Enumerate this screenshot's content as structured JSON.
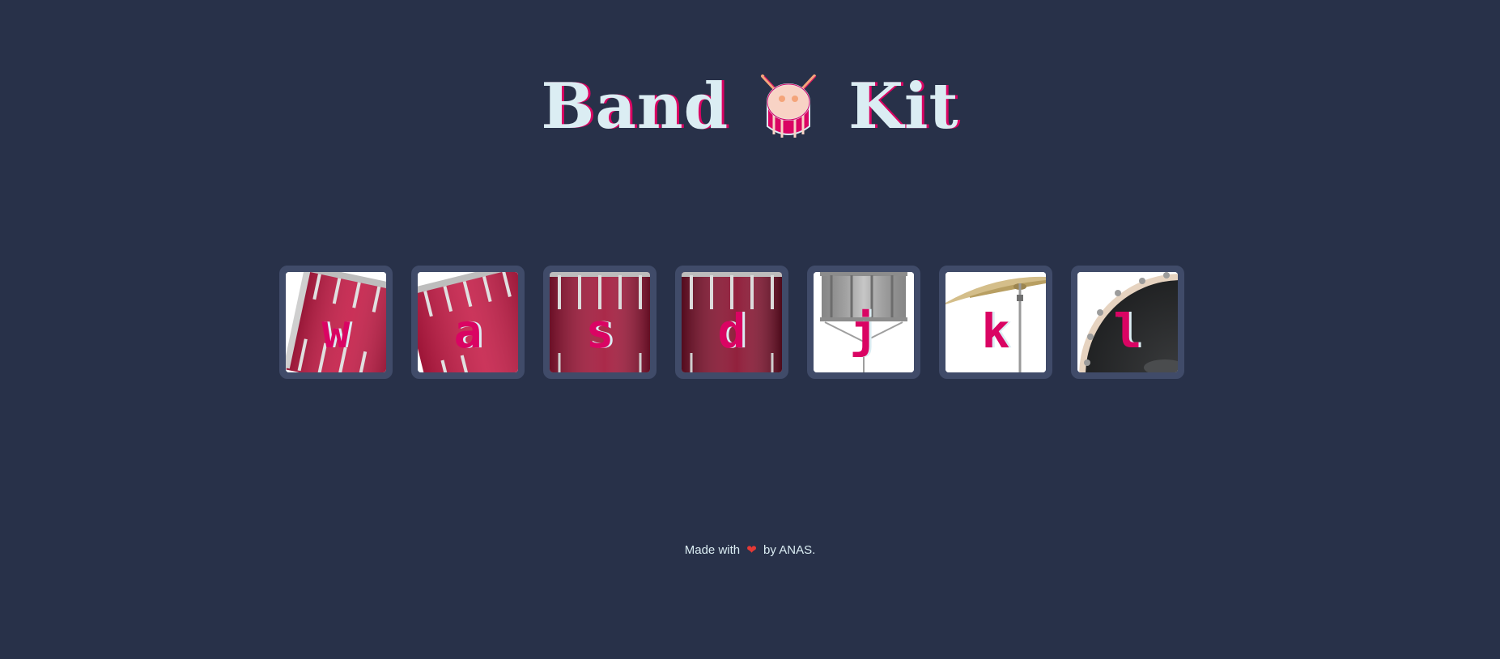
{
  "header": {
    "title_left": "Band",
    "title_right": "Kit",
    "logo_icon": "drum-icon"
  },
  "drums": [
    {
      "key": "w",
      "image": "tom-drum-red-tilted-icon"
    },
    {
      "key": "a",
      "image": "tom-drum-red-tilted-icon"
    },
    {
      "key": "s",
      "image": "snare-drum-red-icon"
    },
    {
      "key": "d",
      "image": "snare-drum-darkred-icon"
    },
    {
      "key": "j",
      "image": "snare-drum-silver-stand-icon"
    },
    {
      "key": "k",
      "image": "crash-cymbal-icon"
    },
    {
      "key": "l",
      "image": "kick-drum-black-icon"
    }
  ],
  "footer": {
    "prefix": "Made with",
    "heart": "❤",
    "suffix": "by ANAS."
  },
  "colors": {
    "background": "#283149",
    "tile_border": "#404B69",
    "accent": "#DA0463",
    "light": "#DBEDF3"
  }
}
